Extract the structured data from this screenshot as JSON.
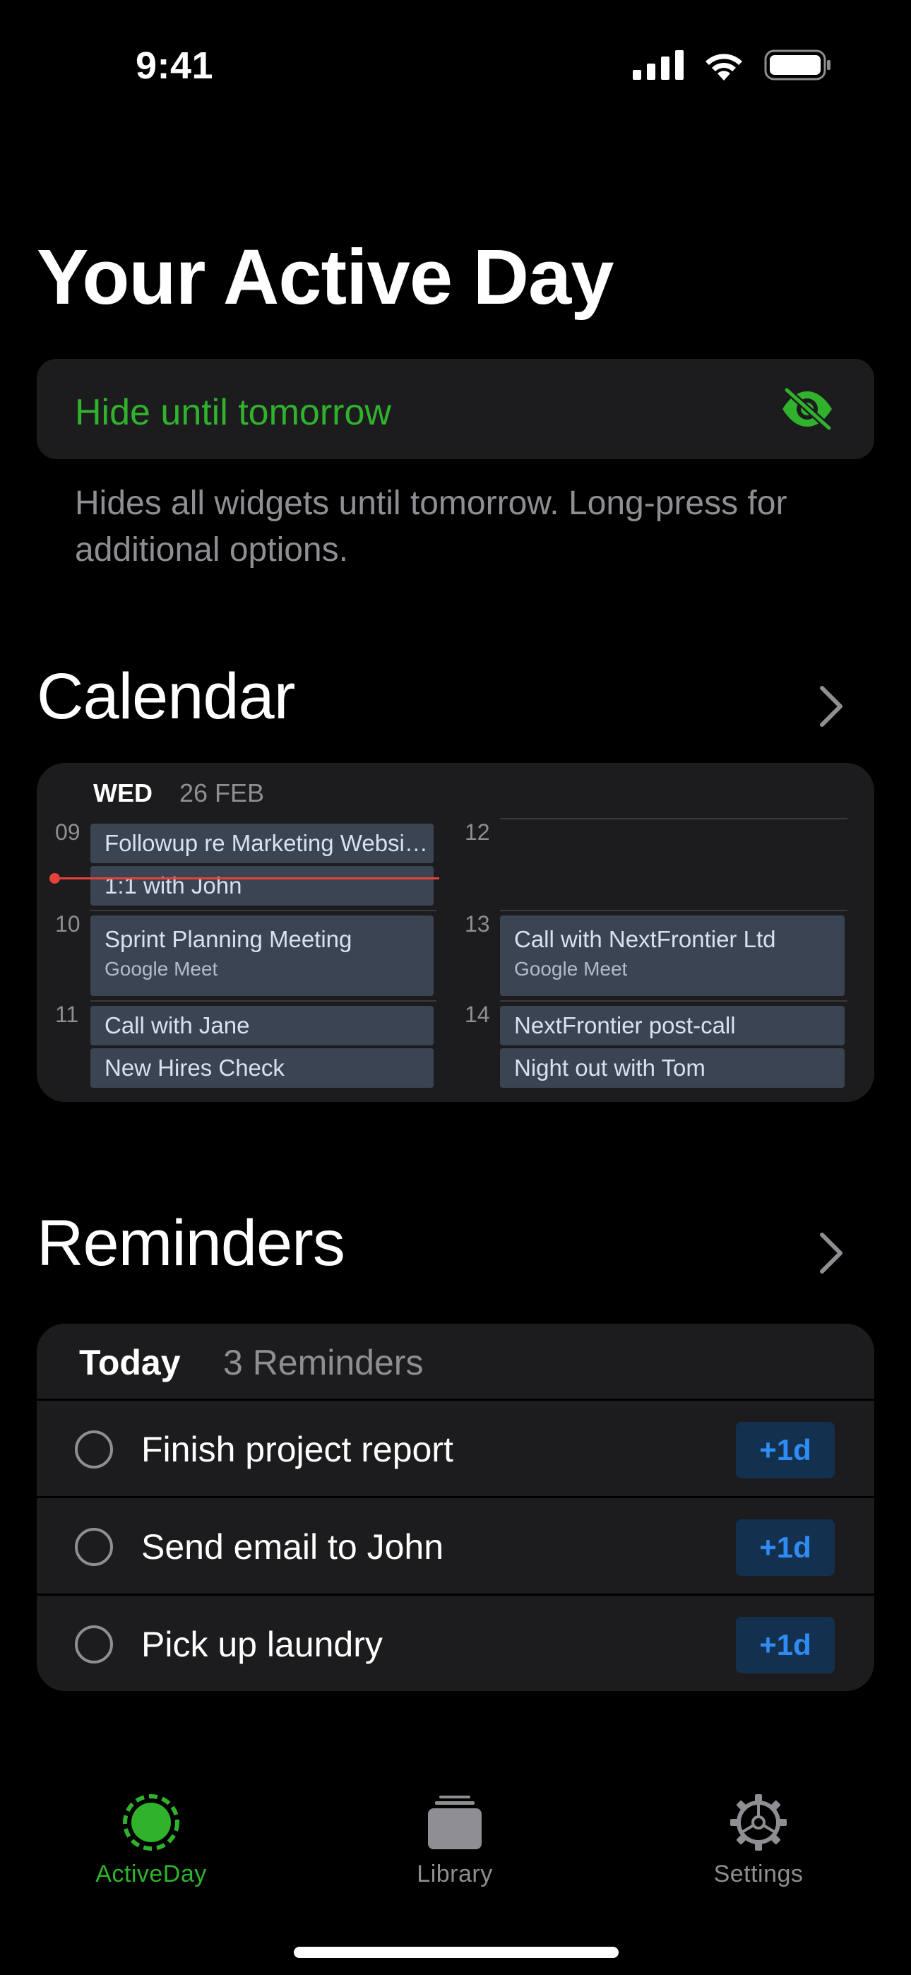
{
  "status_bar": {
    "time": "9:41"
  },
  "page": {
    "title": "Your Active Day"
  },
  "hide_card": {
    "label": "Hide until tomorrow",
    "description": "Hides all widgets until tomorrow. Long-press for additional options.",
    "accent_color": "#30b22c"
  },
  "calendar": {
    "section_title": "Calendar",
    "weekday": "WED",
    "date": "26 FEB",
    "hours": [
      "09",
      "10",
      "11",
      "12",
      "13",
      "14"
    ],
    "events": [
      {
        "title": "Followup re Marketing Websi…"
      },
      {
        "title": "1:1 with John"
      },
      {
        "title": "Sprint Planning Meeting",
        "subtitle": "Google Meet"
      },
      {
        "title": "Call with Jane"
      },
      {
        "title": "New Hires Check"
      },
      {
        "title": "Call with NextFrontier Ltd",
        "subtitle": "Google Meet"
      },
      {
        "title": "NextFrontier post-call"
      },
      {
        "title": "Night out with Tom"
      }
    ]
  },
  "reminders": {
    "section_title": "Reminders",
    "header_label": "Today",
    "header_count": "3 Reminders",
    "items": [
      {
        "text": "Finish project report",
        "action": "+1d"
      },
      {
        "text": "Send email to John",
        "action": "+1d"
      },
      {
        "text": "Pick up laundry",
        "action": "+1d"
      }
    ]
  },
  "tab_bar": {
    "tabs": [
      {
        "label": "ActiveDay",
        "icon": "activeday-icon",
        "active": true
      },
      {
        "label": "Library",
        "icon": "library-icon",
        "active": false
      },
      {
        "label": "Settings",
        "icon": "gear-icon",
        "active": false
      }
    ],
    "active_color": "#30b22c",
    "inactive_color": "#8e8e93"
  }
}
